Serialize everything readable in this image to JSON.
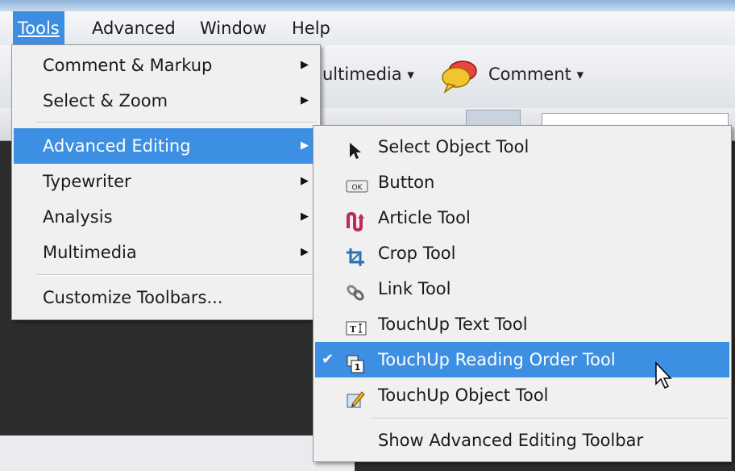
{
  "menubar": {
    "items": [
      {
        "label": "Tools",
        "mnemonic_index": 0
      },
      {
        "label": "Advanced",
        "mnemonic_index": 0
      },
      {
        "label": "Window",
        "mnemonic_index": 0
      },
      {
        "label": "Help",
        "mnemonic_index": 0
      }
    ]
  },
  "toolbar": {
    "multimedia_label": "ultimedia",
    "comment_label": "Comment"
  },
  "tools_menu": {
    "items": [
      {
        "label": "Comment & Markup"
      },
      {
        "label": "Select & Zoom"
      },
      {
        "label": "Advanced Editing"
      },
      {
        "label": "Typewriter"
      },
      {
        "label": "Analysis"
      },
      {
        "label": "Multimedia"
      },
      {
        "label": "Customize Toolbars..."
      }
    ]
  },
  "advanced_editing_menu": {
    "items": [
      {
        "label": "Select Object Tool",
        "icon": "arrow-pointer-icon"
      },
      {
        "label": "Button",
        "icon": "ok-button-icon"
      },
      {
        "label": "Article Tool",
        "icon": "article-icon"
      },
      {
        "label": "Crop Tool",
        "icon": "crop-icon"
      },
      {
        "label": "Link Tool",
        "icon": "link-icon"
      },
      {
        "label": "TouchUp Text Tool",
        "icon": "touchup-text-icon"
      },
      {
        "label": "TouchUp Reading Order Tool",
        "icon": "reading-order-icon",
        "checked": true
      },
      {
        "label": "TouchUp Object Tool",
        "icon": "touchup-object-icon"
      },
      {
        "label": "Show Advanced Editing Toolbar"
      }
    ]
  },
  "colors": {
    "highlight": "#3c8fe2",
    "menu_bg": "#f0f0f0"
  }
}
